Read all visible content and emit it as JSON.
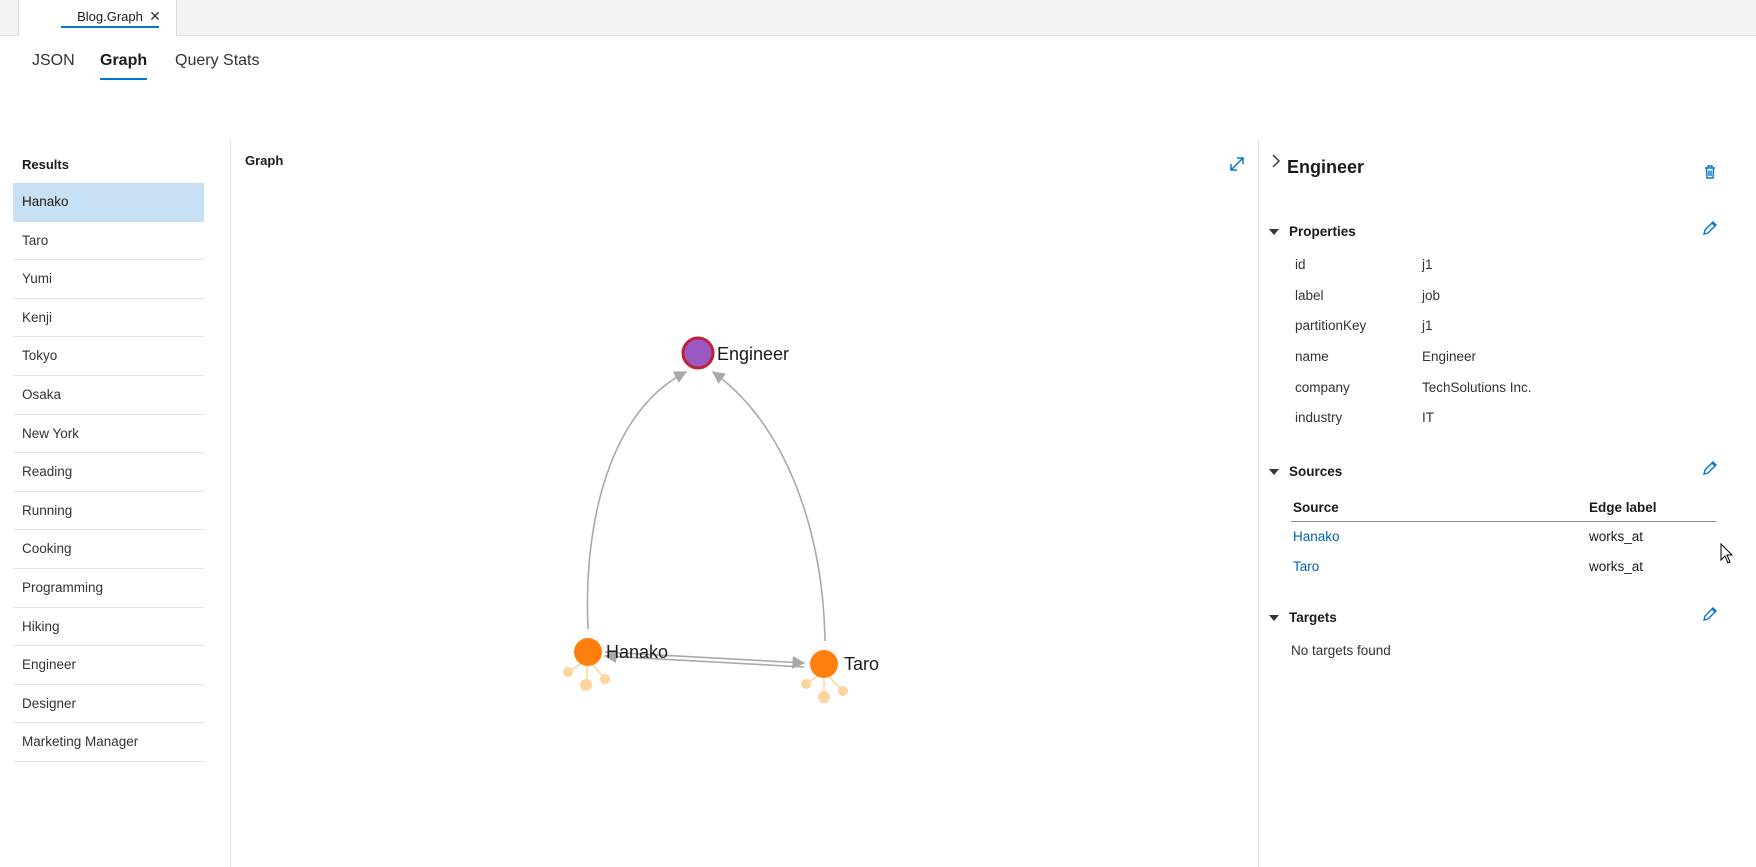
{
  "document_tab": {
    "title": "Blog.Graph",
    "close_glyph": "✕"
  },
  "view_tabs": [
    {
      "label": "JSON",
      "active": false
    },
    {
      "label": "Graph",
      "active": true
    },
    {
      "label": "Query Stats",
      "active": false
    }
  ],
  "results": {
    "heading": "Results",
    "items": [
      "Hanako",
      "Taro",
      "Yumi",
      "Kenji",
      "Tokyo",
      "Osaka",
      "New York",
      "Reading",
      "Running",
      "Cooking",
      "Programming",
      "Hiking",
      "Engineer",
      "Designer",
      "Marketing Manager"
    ],
    "selected_index": 0
  },
  "graph": {
    "heading": "Graph",
    "nodes": [
      {
        "label": "Engineer",
        "kind": "selected",
        "color": "#9b59c4",
        "ring": "#c0203a"
      },
      {
        "label": "Hanako",
        "kind": "vertex",
        "color": "#ff7f0e"
      },
      {
        "label": "Taro",
        "kind": "vertex",
        "color": "#ff7f0e"
      }
    ],
    "edge_color": "#a9a9a9",
    "expander_color": "#fdd49e"
  },
  "details": {
    "title": "Engineer",
    "properties": {
      "heading": "Properties",
      "rows": [
        {
          "key": "id",
          "value": "j1"
        },
        {
          "key": "label",
          "value": "job"
        },
        {
          "key": "partitionKey",
          "value": "j1"
        },
        {
          "key": "name",
          "value": "Engineer"
        },
        {
          "key": "company",
          "value": "TechSolutions Inc."
        },
        {
          "key": "industry",
          "value": "IT"
        }
      ]
    },
    "sources": {
      "heading": "Sources",
      "columns": [
        "Source",
        "Edge label"
      ],
      "rows": [
        {
          "source": "Hanako",
          "edge_label": "works_at"
        },
        {
          "source": "Taro",
          "edge_label": "works_at"
        }
      ]
    },
    "targets": {
      "heading": "Targets",
      "empty_text": "No targets found"
    }
  },
  "colors": {
    "accent": "#0078d4",
    "selected_row": "#c7e0f4",
    "link": "#0063b1"
  }
}
